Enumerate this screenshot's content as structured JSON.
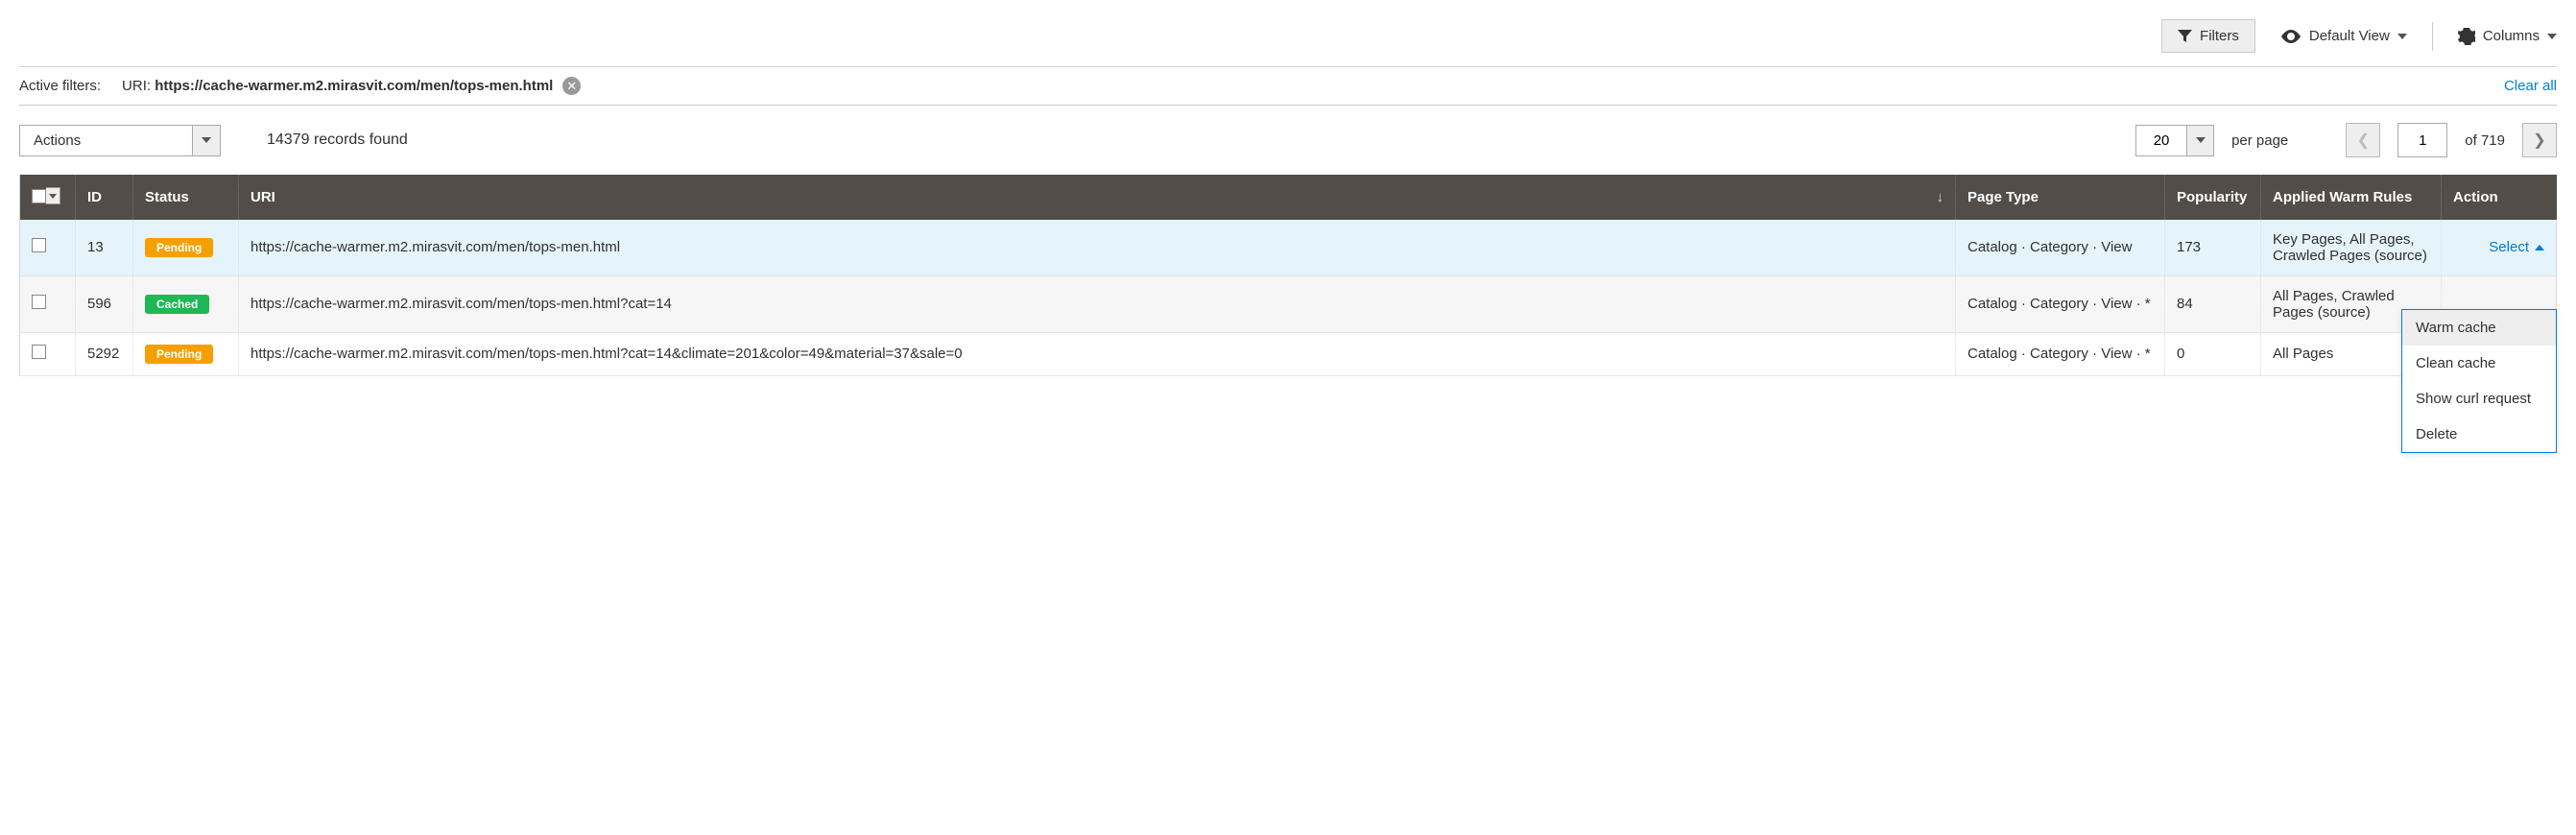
{
  "toolbar": {
    "filters_label": "Filters",
    "default_view_label": "Default View",
    "columns_label": "Columns"
  },
  "active_filters": {
    "label": "Active filters:",
    "chip_prefix": "URI:",
    "chip_value": "https://cache-warmer.m2.mirasvit.com/men/tops-men.html",
    "clear_all": "Clear all"
  },
  "controls": {
    "actions_label": "Actions",
    "records_found": "14379 records found",
    "page_size": "20",
    "per_page": "per page",
    "current_page": "1",
    "of_label": "of 719"
  },
  "columns": {
    "id": "ID",
    "status": "Status",
    "uri": "URI",
    "page_type": "Page Type",
    "popularity": "Popularity",
    "rules": "Applied Warm Rules",
    "action": "Action"
  },
  "rows": [
    {
      "id": "13",
      "status_label": "Pending",
      "status_kind": "pending",
      "uri": "https://cache-warmer.m2.mirasvit.com/men/tops-men.html",
      "page_type": "Catalog · Category · View",
      "popularity": "173",
      "rules": "Key Pages, All Pages, Crawled Pages (source)",
      "select_label": "Select"
    },
    {
      "id": "596",
      "status_label": "Cached",
      "status_kind": "cached",
      "uri": "https://cache-warmer.m2.mirasvit.com/men/tops-men.html?cat=14",
      "page_type": "Catalog · Category · View · *",
      "popularity": "84",
      "rules": "All Pages, Crawled Pages (source)"
    },
    {
      "id": "5292",
      "status_label": "Pending",
      "status_kind": "pending",
      "uri": "https://cache-warmer.m2.mirasvit.com/men/tops-men.html?cat=14&climate=201&color=49&material=37&sale=0",
      "page_type": "Catalog · Category · View · *",
      "popularity": "0",
      "rules": "All Pages"
    }
  ],
  "action_menu": {
    "warm": "Warm cache",
    "clean": "Clean cache",
    "curl": "Show curl request",
    "delete": "Delete"
  }
}
